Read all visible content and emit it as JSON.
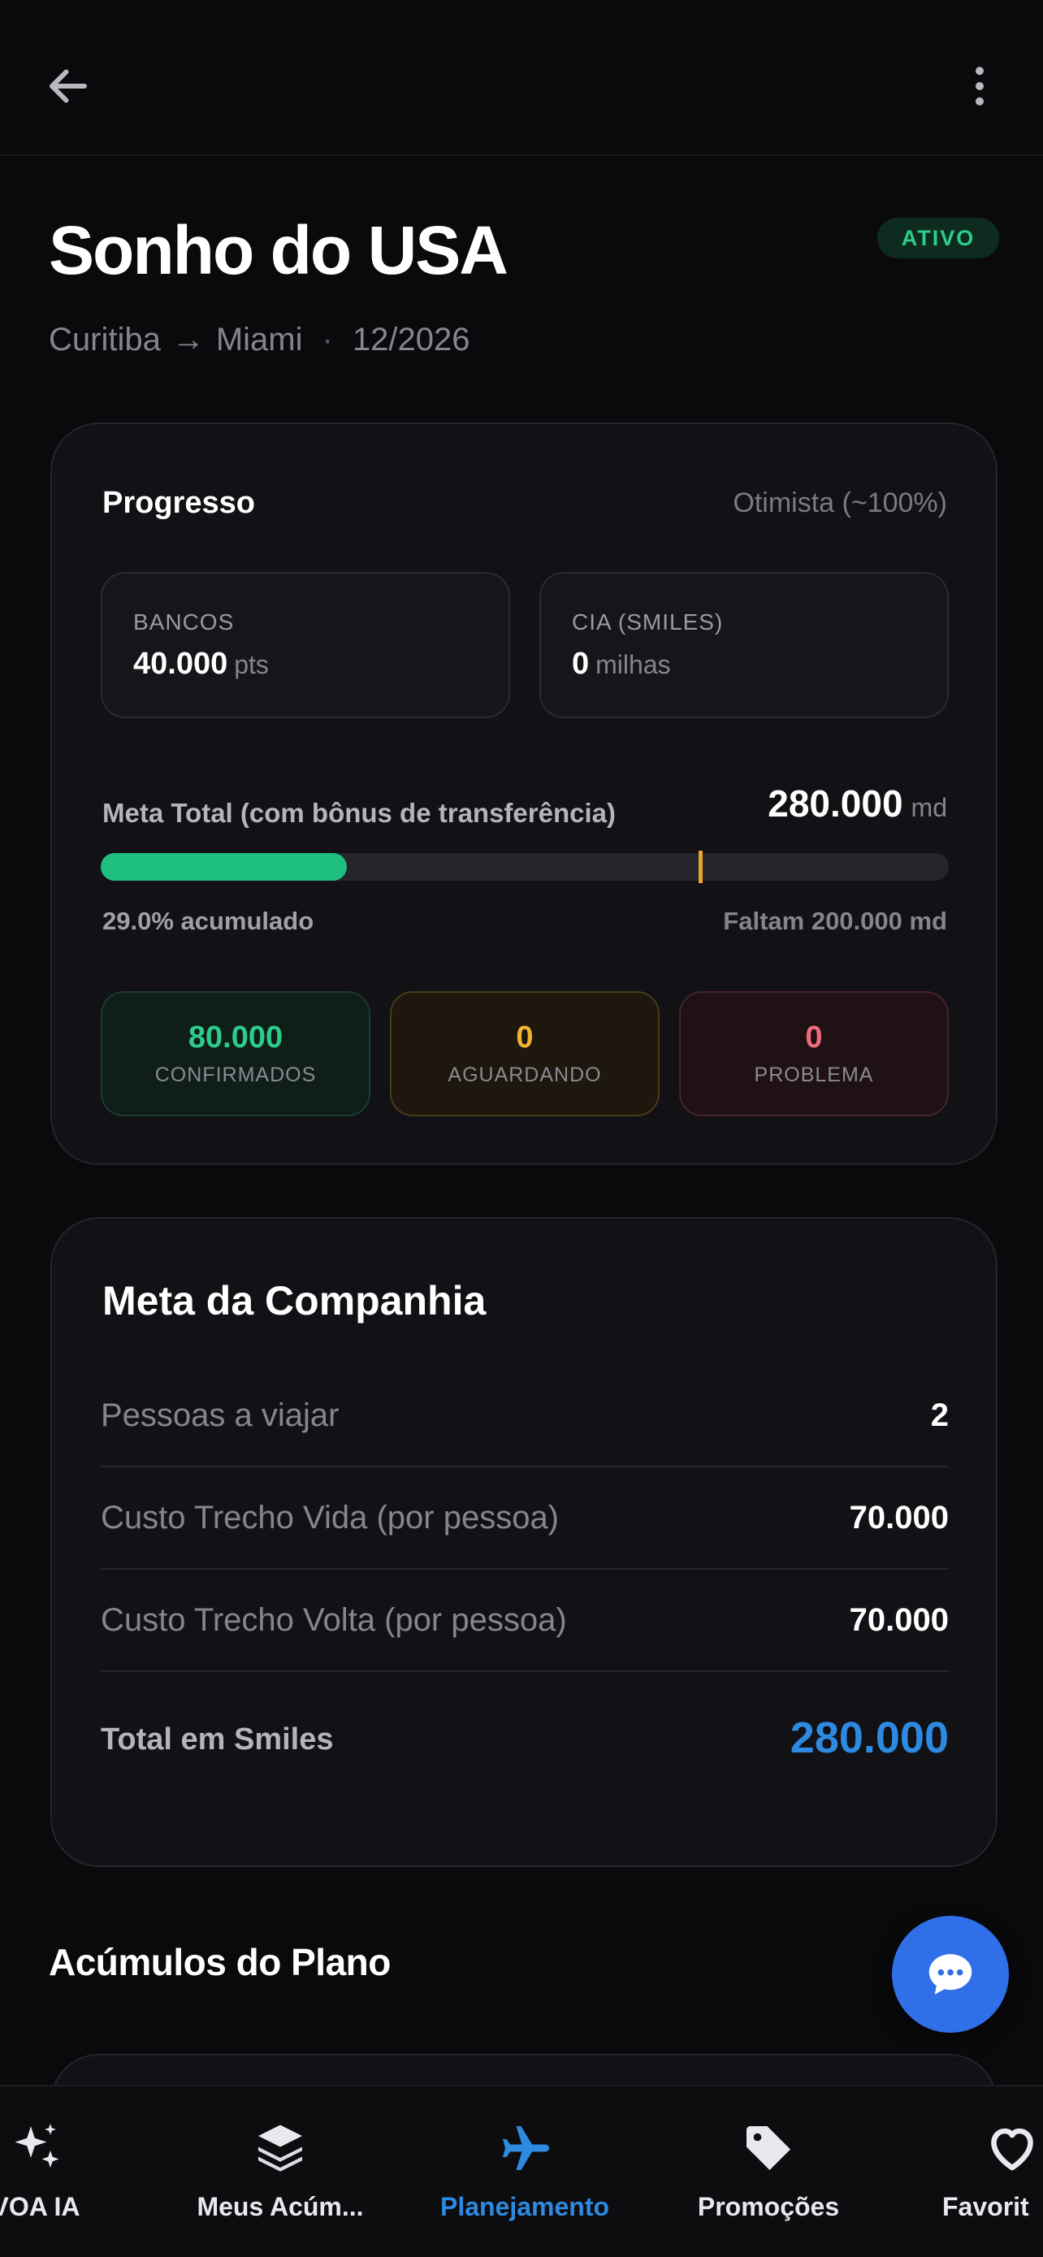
{
  "header": {
    "back_icon": "arrow-left-icon",
    "more_icon": "more-vertical-icon"
  },
  "plan": {
    "title": "Sonho do USA",
    "status": "ATIVO",
    "origin": "Curitiba",
    "route_arrow": "→",
    "destination": "Miami",
    "separator": "·",
    "date": "12/2026"
  },
  "progress": {
    "title": "Progresso",
    "mode": "Otimista (~100%)",
    "banks": {
      "label": "BANCOS",
      "value": "40.000",
      "unit": "pts"
    },
    "airline": {
      "label": "CIA (SMILES)",
      "value": "0",
      "unit": "milhas"
    },
    "goal_label": "Meta Total (com bônus de transferência)",
    "goal_value": "280.000",
    "goal_unit": "md",
    "progress_fraction": 0.29,
    "marker_fraction": 0.705,
    "accumulated_text": "29.0% acumulado",
    "remaining_text": "Faltam 200.000 md",
    "stats": {
      "confirmed": {
        "value": "80.000",
        "label": "CONFIRMADOS"
      },
      "waiting": {
        "value": "0",
        "label": "AGUARDANDO"
      },
      "problem": {
        "value": "0",
        "label": "PROBLEMA"
      }
    }
  },
  "company_goal": {
    "title": "Meta da Companhia",
    "rows": [
      {
        "label": "Pessoas a viajar",
        "value": "2"
      },
      {
        "label": "Custo Trecho Vida (por pessoa)",
        "value": "70.000"
      },
      {
        "label": "Custo Trecho Volta (por pessoa)",
        "value": "70.000"
      }
    ],
    "total_label": "Total em Smiles",
    "total_value": "280.000"
  },
  "accumulations": {
    "title": "Acúmulos do Plano"
  },
  "fab": {
    "icon": "chat-bubble-icon"
  },
  "nav": {
    "items": [
      {
        "label": "VOA IA",
        "icon": "sparkles-icon"
      },
      {
        "label": "Meus Acúm...",
        "icon": "layers-icon"
      },
      {
        "label": "Planejamento",
        "icon": "airplane-icon",
        "active": true
      },
      {
        "label": "Promoções",
        "icon": "tag-icon"
      },
      {
        "label": "Favorit",
        "icon": "heart-icon"
      }
    ],
    "active_color": "#2d8ae0"
  }
}
